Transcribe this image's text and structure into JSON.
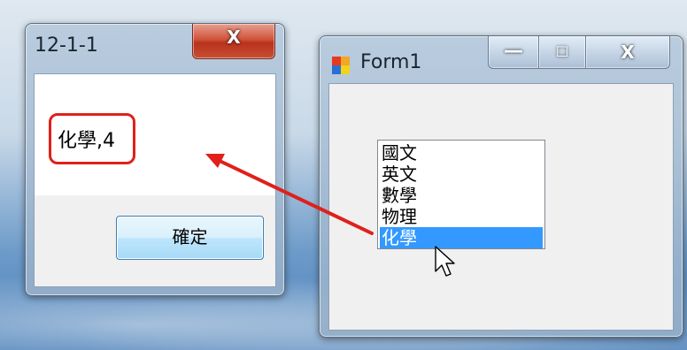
{
  "msgbox": {
    "title": "12-1-1",
    "close_glyph": "X",
    "message": "化學,4",
    "ok_label": "確定"
  },
  "form1": {
    "title": "Form1",
    "min_glyph": "—",
    "max_glyph": "☐",
    "close_glyph": "X",
    "listbox": {
      "items": [
        "國文",
        "英文",
        "數學",
        "物理",
        "化學"
      ],
      "selected": "化學"
    }
  },
  "annotation": {
    "color": "#e0201a"
  },
  "icons": {
    "cursor": "arrow-cursor-icon",
    "app": "form-app-icon"
  }
}
